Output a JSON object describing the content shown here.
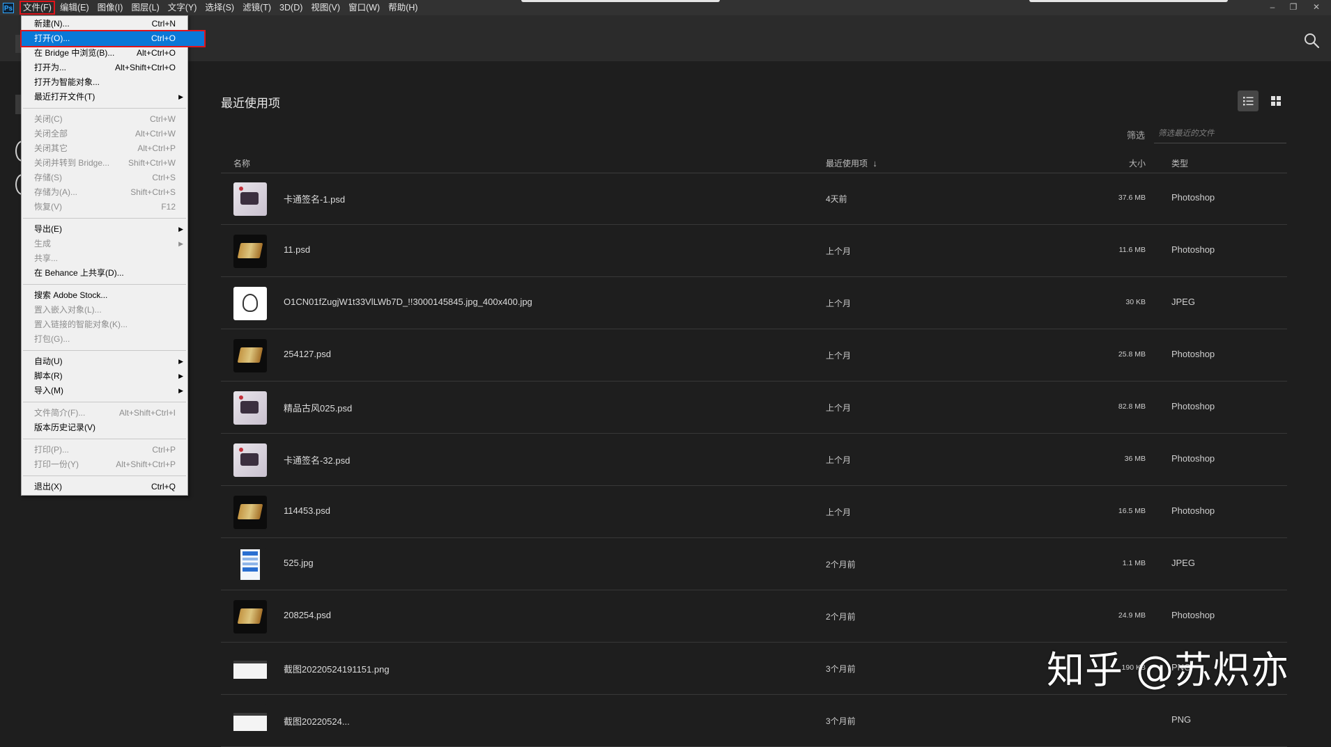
{
  "app": {
    "logo": "Ps"
  },
  "menubar": {
    "items": [
      "文件(F)",
      "编辑(E)",
      "图像(I)",
      "图层(L)",
      "文字(Y)",
      "选择(S)",
      "滤镜(T)",
      "3D(D)",
      "视图(V)",
      "窗口(W)",
      "帮助(H)"
    ],
    "active_index": 0
  },
  "window_controls": {
    "minimize": "–",
    "restore": "❐",
    "close": "✕"
  },
  "file_menu": {
    "items": [
      {
        "label": "新建(N)...",
        "shortcut": "Ctrl+N",
        "disabled": false
      },
      {
        "label": "打开(O)...",
        "shortcut": "Ctrl+O",
        "disabled": false,
        "highlighted": true
      },
      {
        "label": "在 Bridge 中浏览(B)...",
        "shortcut": "Alt+Ctrl+O",
        "disabled": false
      },
      {
        "label": "打开为...",
        "shortcut": "Alt+Shift+Ctrl+O",
        "disabled": false
      },
      {
        "label": "打开为智能对象...",
        "shortcut": "",
        "disabled": false
      },
      {
        "label": "最近打开文件(T)",
        "shortcut": "",
        "disabled": false,
        "submenu": true
      },
      {
        "separator": true
      },
      {
        "label": "关闭(C)",
        "shortcut": "Ctrl+W",
        "disabled": true
      },
      {
        "label": "关闭全部",
        "shortcut": "Alt+Ctrl+W",
        "disabled": true
      },
      {
        "label": "关闭其它",
        "shortcut": "Alt+Ctrl+P",
        "disabled": true
      },
      {
        "label": "关闭并转到 Bridge...",
        "shortcut": "Shift+Ctrl+W",
        "disabled": true
      },
      {
        "label": "存储(S)",
        "shortcut": "Ctrl+S",
        "disabled": true
      },
      {
        "label": "存储为(A)...",
        "shortcut": "Shift+Ctrl+S",
        "disabled": true
      },
      {
        "label": "恢复(V)",
        "shortcut": "F12",
        "disabled": true
      },
      {
        "separator": true
      },
      {
        "label": "导出(E)",
        "shortcut": "",
        "disabled": false,
        "submenu": true
      },
      {
        "label": "生成",
        "shortcut": "",
        "disabled": true,
        "submenu": true
      },
      {
        "label": "共享...",
        "shortcut": "",
        "disabled": true
      },
      {
        "label": "在 Behance 上共享(D)...",
        "shortcut": "",
        "disabled": false
      },
      {
        "separator": true
      },
      {
        "label": "搜索 Adobe Stock...",
        "shortcut": "",
        "disabled": false
      },
      {
        "label": "置入嵌入对象(L)...",
        "shortcut": "",
        "disabled": true
      },
      {
        "label": "置入链接的智能对象(K)...",
        "shortcut": "",
        "disabled": true
      },
      {
        "label": "打包(G)...",
        "shortcut": "",
        "disabled": true
      },
      {
        "separator": true
      },
      {
        "label": "自动(U)",
        "shortcut": "",
        "disabled": false,
        "submenu": true
      },
      {
        "label": "脚本(R)",
        "shortcut": "",
        "disabled": false,
        "submenu": true
      },
      {
        "label": "导入(M)",
        "shortcut": "",
        "disabled": false,
        "submenu": true
      },
      {
        "separator": true
      },
      {
        "label": "文件简介(F)...",
        "shortcut": "Alt+Shift+Ctrl+I",
        "disabled": true
      },
      {
        "label": "版本历史记录(V)",
        "shortcut": "",
        "disabled": false
      },
      {
        "separator": true
      },
      {
        "label": "打印(P)...",
        "shortcut": "Ctrl+P",
        "disabled": true
      },
      {
        "label": "打印一份(Y)",
        "shortcut": "Alt+Shift+Ctrl+P",
        "disabled": true
      },
      {
        "separator": true
      },
      {
        "label": "退出(X)",
        "shortcut": "Ctrl+Q",
        "disabled": false
      }
    ]
  },
  "home": {
    "section_title": "最近使用项",
    "filter_label": "筛选",
    "filter_placeholder": "筛选最近的文件",
    "columns": {
      "name": "名称",
      "recent": "最近使用项",
      "sort_arrow": "↓",
      "size": "大小",
      "type": "类型"
    },
    "files": [
      {
        "name": "卡通签名-1.psd",
        "recent": "4天前",
        "size": "37.6 MB",
        "type": "Photoshop",
        "thumb": "light"
      },
      {
        "name": "11.psd",
        "recent": "上个月",
        "size": "11.6 MB",
        "type": "Photoshop",
        "thumb": "dark-gold"
      },
      {
        "name": "O1CN01fZugjW1t33VlLWb7D_!!3000145845.jpg_400x400.jpg",
        "recent": "上个月",
        "size": "30 KB",
        "type": "JPEG",
        "thumb": "white"
      },
      {
        "name": "254127.psd",
        "recent": "上个月",
        "size": "25.8 MB",
        "type": "Photoshop",
        "thumb": "dark-gold"
      },
      {
        "name": "精品古风025.psd",
        "recent": "上个月",
        "size": "82.8 MB",
        "type": "Photoshop",
        "thumb": "light"
      },
      {
        "name": "卡通签名-32.psd",
        "recent": "上个月",
        "size": "36 MB",
        "type": "Photoshop",
        "thumb": "light"
      },
      {
        "name": "114453.psd",
        "recent": "上个月",
        "size": "16.5 MB",
        "type": "Photoshop",
        "thumb": "dark-gold"
      },
      {
        "name": "525.jpg",
        "recent": "2个月前",
        "size": "1.1 MB",
        "type": "JPEG",
        "thumb": "blue-doc"
      },
      {
        "name": "208254.psd",
        "recent": "2个月前",
        "size": "24.9 MB",
        "type": "Photoshop",
        "thumb": "dark-gold"
      },
      {
        "name": "截图20220524191151.png",
        "recent": "3个月前",
        "size": "190 KB",
        "type": "PNG",
        "thumb": "screenshot"
      },
      {
        "name": "截图20220524...",
        "recent": "3个月前",
        "size": "",
        "type": "PNG",
        "thumb": "screenshot"
      }
    ]
  },
  "watermark": "知乎 @苏炽亦",
  "colors": {
    "accent": "#0a78d7",
    "highlight_border": "#e0141b",
    "background": "#1e1e1e"
  }
}
